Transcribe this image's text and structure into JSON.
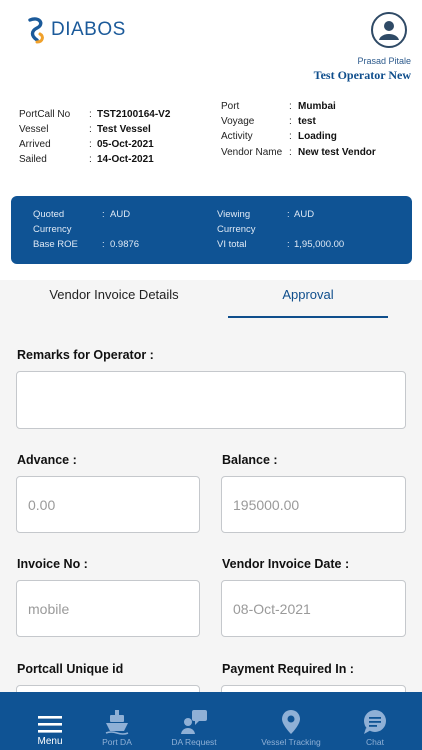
{
  "brand": {
    "name": "DIABOS"
  },
  "user": {
    "name": "Prasad Pitale",
    "role": "Test Operator New"
  },
  "info": {
    "left": [
      {
        "key": "PortCall No",
        "value": "TST2100164-V2"
      },
      {
        "key": "Vessel",
        "value": "Test Vessel"
      },
      {
        "key": "Arrived",
        "value": "05-Oct-2021"
      },
      {
        "key": "Sailed",
        "value": "14-Oct-2021"
      }
    ],
    "right": [
      {
        "key": "Port",
        "value": "Mumbai"
      },
      {
        "key": "Voyage",
        "value": "test"
      },
      {
        "key": "Activity",
        "value": "Loading"
      },
      {
        "key": "Vendor Name",
        "value": "New test Vendor"
      }
    ]
  },
  "summary": {
    "quoted_currency_label_1": "Quoted",
    "quoted_currency_label_2": "Currency",
    "quoted_currency_value": "AUD",
    "base_roe_label": "Base ROE",
    "base_roe_value": "0.9876",
    "viewing_currency_label_1": "Viewing",
    "viewing_currency_label_2": "Currency",
    "viewing_currency_value": "AUD",
    "vi_total_label": "VI total",
    "vi_total_value": "1,95,000.00"
  },
  "tabs": [
    {
      "label": "Vendor Invoice Details",
      "active": false
    },
    {
      "label": "Approval",
      "active": true
    }
  ],
  "form": {
    "remarks_label": "Remarks for Operator :",
    "remarks_value": "",
    "advance_label": "Advance :",
    "advance_placeholder": "0.00",
    "balance_label": "Balance :",
    "balance_placeholder": "195000.00",
    "invoice_no_label": "Invoice No :",
    "invoice_no_placeholder": "mobile",
    "vendor_invoice_date_label": "Vendor Invoice Date :",
    "vendor_invoice_date_placeholder": "08-Oct-2021",
    "portcall_unique_id_label": "Portcall Unique id",
    "payment_required_in_label": "Payment Required In :"
  },
  "nav": [
    {
      "label": "Menu",
      "icon": "menu-icon",
      "active": true
    },
    {
      "label": "Port DA",
      "icon": "ship-icon",
      "active": false
    },
    {
      "label": "DA Request",
      "icon": "da-request-icon",
      "active": false
    },
    {
      "label": "Vessel Tracking",
      "icon": "location-pin-icon",
      "active": false
    },
    {
      "label": "Chat",
      "icon": "chat-icon",
      "active": false
    }
  ],
  "colors": {
    "primary": "#0f5394",
    "accent": "#0f4e8c",
    "inactive_nav": "#8fb0d6"
  }
}
